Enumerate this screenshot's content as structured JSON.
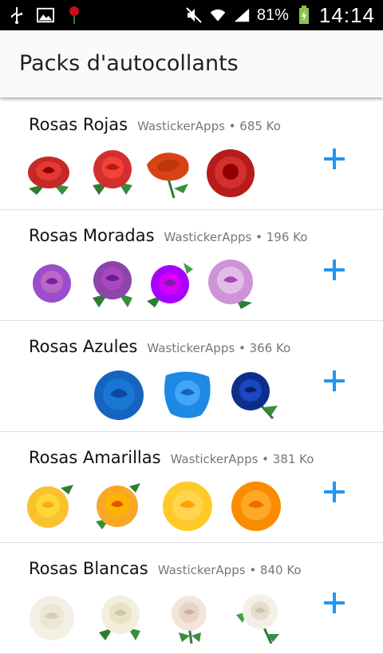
{
  "status_bar": {
    "battery_percent": "81%",
    "time": "14:14",
    "icons": [
      "usb-icon",
      "image-icon",
      "rose-notification-icon",
      "mute-icon",
      "wifi-icon",
      "signal-icon",
      "battery-icon"
    ]
  },
  "app_bar": {
    "title": "Packs d'autocollants"
  },
  "colors": {
    "accent": "#2196f3"
  },
  "packs": [
    {
      "name": "Rosas Rojas",
      "meta": "WastickerApps • 685 Ko",
      "sticker_color": "red",
      "add_icon": "plus-icon"
    },
    {
      "name": "Rosas Moradas",
      "meta": "WastickerApps • 196 Ko",
      "sticker_color": "purple",
      "add_icon": "plus-icon"
    },
    {
      "name": "Rosas Azules",
      "meta": "WastickerApps • 366 Ko",
      "sticker_color": "blue",
      "add_icon": "plus-icon"
    },
    {
      "name": "Rosas Amarillas",
      "meta": "WastickerApps • 381 Ko",
      "sticker_color": "yellow",
      "add_icon": "plus-icon"
    },
    {
      "name": "Rosas Blancas",
      "meta": "WastickerApps • 840 Ko",
      "sticker_color": "white",
      "add_icon": "plus-icon"
    }
  ]
}
